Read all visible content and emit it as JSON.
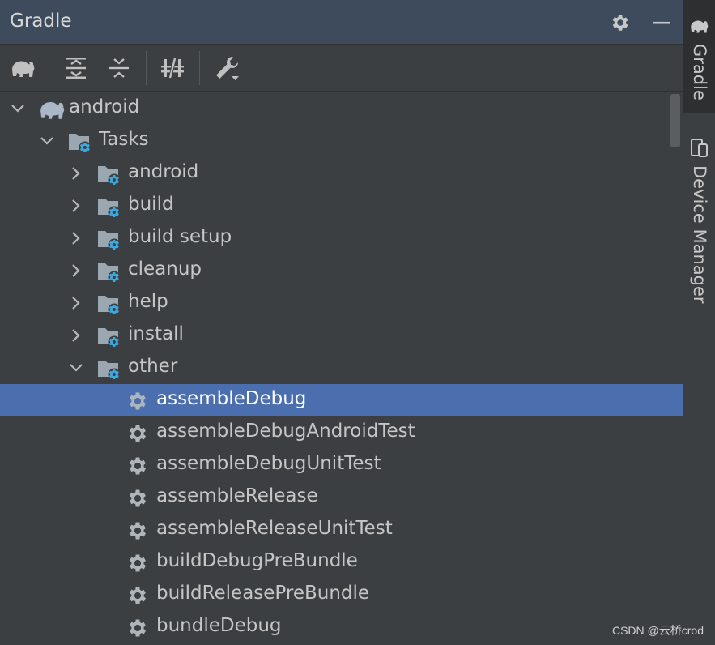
{
  "window": {
    "title": "Gradle"
  },
  "colors": {
    "header_bg": "#3d4b5c",
    "selection": "#4b6eaf",
    "gear_blue": "#3ea8de",
    "panel_bg": "#3c3f41"
  },
  "toolbar": {
    "items": [
      {
        "name": "elephant-icon"
      },
      {
        "name": "expand-all-icon"
      },
      {
        "name": "collapse-all-icon"
      },
      {
        "name": "toggle-offline-icon"
      },
      {
        "name": "wrench-icon"
      }
    ]
  },
  "tree": {
    "items": [
      {
        "label": "android",
        "depth": 0,
        "expanded": true,
        "icon": "gradle-project-icon"
      },
      {
        "label": "Tasks",
        "depth": 1,
        "expanded": true,
        "icon": "task-folder-icon"
      },
      {
        "label": "android",
        "depth": 2,
        "expanded": false,
        "icon": "task-folder-icon"
      },
      {
        "label": "build",
        "depth": 2,
        "expanded": false,
        "icon": "task-folder-icon"
      },
      {
        "label": "build setup",
        "depth": 2,
        "expanded": false,
        "icon": "task-folder-icon"
      },
      {
        "label": "cleanup",
        "depth": 2,
        "expanded": false,
        "icon": "task-folder-icon"
      },
      {
        "label": "help",
        "depth": 2,
        "expanded": false,
        "icon": "task-folder-icon"
      },
      {
        "label": "install",
        "depth": 2,
        "expanded": false,
        "icon": "task-folder-icon"
      },
      {
        "label": "other",
        "depth": 2,
        "expanded": true,
        "icon": "task-folder-icon"
      },
      {
        "label": "assembleDebug",
        "depth": 3,
        "icon": "task-gear-icon",
        "selected": true
      },
      {
        "label": "assembleDebugAndroidTest",
        "depth": 3,
        "icon": "task-gear-icon"
      },
      {
        "label": "assembleDebugUnitTest",
        "depth": 3,
        "icon": "task-gear-icon"
      },
      {
        "label": "assembleRelease",
        "depth": 3,
        "icon": "task-gear-icon"
      },
      {
        "label": "assembleReleaseUnitTest",
        "depth": 3,
        "icon": "task-gear-icon"
      },
      {
        "label": "buildDebugPreBundle",
        "depth": 3,
        "icon": "task-gear-icon"
      },
      {
        "label": "buildReleasePreBundle",
        "depth": 3,
        "icon": "task-gear-icon"
      },
      {
        "label": "bundleDebug",
        "depth": 3,
        "icon": "task-gear-icon"
      }
    ]
  },
  "right_tabs": [
    {
      "label": "Gradle",
      "icon": "gradle-tab-icon",
      "active": true
    },
    {
      "label": "Device Manager",
      "icon": "device-manager-icon",
      "active": false
    }
  ],
  "watermark": "CSDN @云桥crod"
}
